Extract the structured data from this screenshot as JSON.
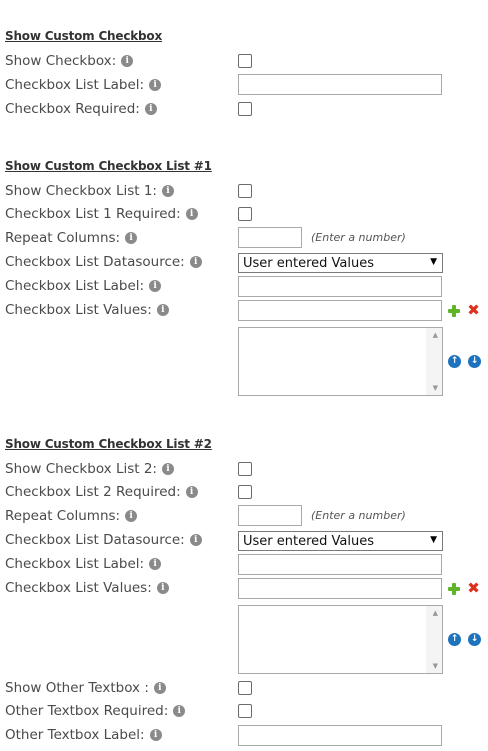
{
  "section1": {
    "title": "Show Custom Checkbox",
    "show_checkbox_label": "Show Checkbox:",
    "list_label": "Checkbox List Label:",
    "required_label": "Checkbox Required:"
  },
  "section2": {
    "title": "Show Custom Checkbox List #1",
    "show_list_label": "Show Checkbox List 1:",
    "required_label": "Checkbox List 1 Required:",
    "repeat_columns_label": "Repeat Columns:",
    "repeat_hint": "(Enter a number)",
    "datasource_label": "Checkbox List Datasource:",
    "datasource_value": "User entered Values",
    "list_label": "Checkbox List Label:",
    "values_label": "Checkbox List Values:"
  },
  "section3": {
    "title": "Show Custom Checkbox List #2",
    "show_list_label": "Show Checkbox List 2:",
    "required_label": "Checkbox List 2 Required:",
    "repeat_columns_label": "Repeat Columns:",
    "repeat_hint": "(Enter a number)",
    "datasource_label": "Checkbox List Datasource:",
    "datasource_value": "User entered Values",
    "list_label": "Checkbox List Label:",
    "values_label": "Checkbox List Values:",
    "show_other_label": "Show Other Textbox :",
    "other_required_label": "Other Textbox Required:",
    "other_label_label": "Other Textbox Label:"
  },
  "icons": {
    "info": "info-icon",
    "add": "plus-icon",
    "delete": "x-icon",
    "move_up": "arrow-up-icon",
    "move_down": "arrow-down-icon",
    "dropdown": "chevron-down-icon"
  },
  "colors": {
    "info_icon": "#8a8a8a",
    "add_icon": "#5fb52a",
    "delete_icon": "#e0301e",
    "move_icon": "#1e73be"
  }
}
